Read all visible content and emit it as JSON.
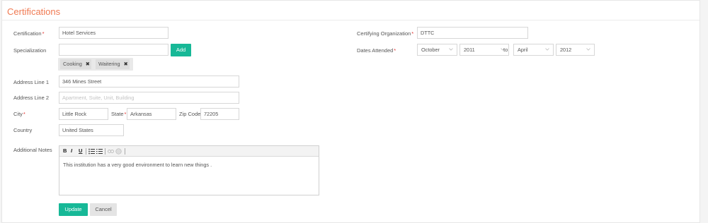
{
  "panel": {
    "title": "Certifications"
  },
  "form": {
    "certification": {
      "label": "Certification",
      "value": "Hotel Services"
    },
    "specialization": {
      "label": "Specialization",
      "value": "",
      "add_label": "Add",
      "tags": [
        "Cooking",
        "Waitering"
      ],
      "remove_icon": "✖"
    },
    "certifying_org": {
      "label": "Certifying Organization",
      "value": "DTTC"
    },
    "dates_attended": {
      "label": "Dates Attended",
      "from_month": "October",
      "from_year": "2011",
      "to_label": "to",
      "to_month": "April",
      "to_year": "2012"
    },
    "address1": {
      "label": "Address Line 1",
      "value": "346 Mines Street"
    },
    "address2": {
      "label": "Address Line 2",
      "placeholder": "Apartment, Suite, Unit, Building"
    },
    "city": {
      "label": "City",
      "value": "Little Rock"
    },
    "state": {
      "label": "State",
      "value": "Arkansas"
    },
    "zip": {
      "label": "Zip Code",
      "value": "72205"
    },
    "country": {
      "label": "Country",
      "value": "United States"
    },
    "notes": {
      "label": "Additional Notes",
      "toolbar": {
        "bold": "B",
        "italic": "I",
        "underline": "U"
      },
      "text": "This institution has a very good environment to learn new things ."
    },
    "required_mark": "*"
  },
  "actions": {
    "update_label": "Update",
    "cancel_label": "Cancel"
  },
  "colors": {
    "accent": "#17b897",
    "title": "#f07a52",
    "required": "#e2332f"
  }
}
